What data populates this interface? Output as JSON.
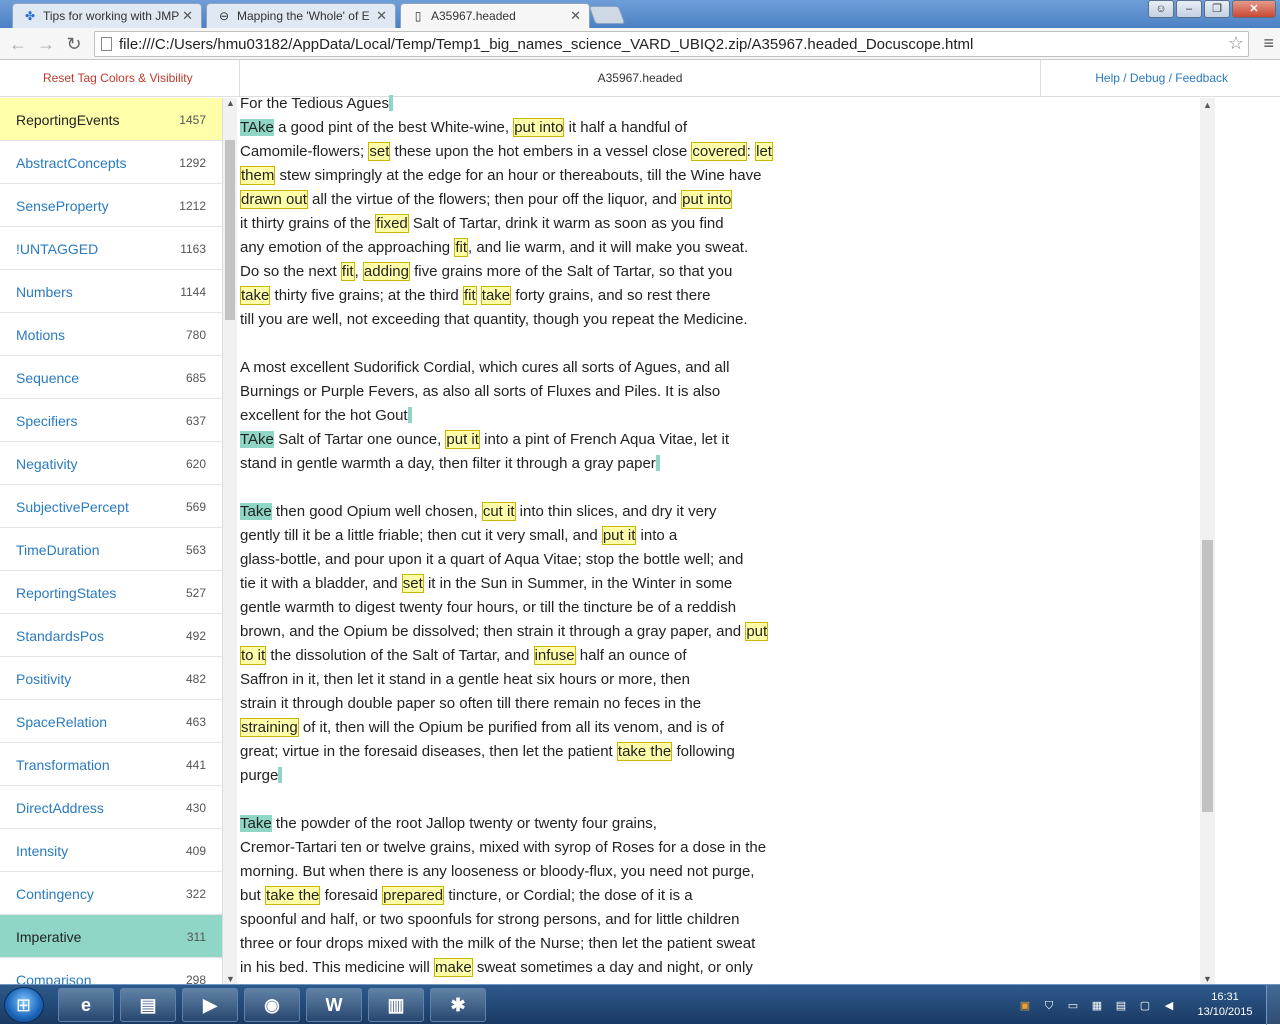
{
  "browser": {
    "tabs": [
      {
        "label": "Tips for working with JMP",
        "icon": "jmp-favicon"
      },
      {
        "label": "Mapping the 'Whole' of E",
        "icon": "globe-favicon"
      },
      {
        "label": "A35967.headed",
        "icon": "page-favicon"
      }
    ],
    "url": "file:///C:/Users/hmu03182/AppData/Local/Temp/Temp1_big_names_science_VARD_UBIQ2.zip/A35967.headed_Docuscope.html"
  },
  "page": {
    "reset_label": "Reset Tag Colors & Visibility",
    "title": "A35967.headed",
    "help_label": "Help / Debug / Feedback"
  },
  "sidebar": {
    "items": [
      {
        "label": "ReportingEvents",
        "count": "1457",
        "state": "yellow"
      },
      {
        "label": "AbstractConcepts",
        "count": "1292",
        "state": ""
      },
      {
        "label": "SenseProperty",
        "count": "1212",
        "state": ""
      },
      {
        "label": "!UNTAGGED",
        "count": "1163",
        "state": ""
      },
      {
        "label": "Numbers",
        "count": "1144",
        "state": ""
      },
      {
        "label": "Motions",
        "count": "780",
        "state": ""
      },
      {
        "label": "Sequence",
        "count": "685",
        "state": ""
      },
      {
        "label": "Specifiers",
        "count": "637",
        "state": ""
      },
      {
        "label": "Negativity",
        "count": "620",
        "state": ""
      },
      {
        "label": "SubjectivePercept",
        "count": "569",
        "state": ""
      },
      {
        "label": "TimeDuration",
        "count": "563",
        "state": ""
      },
      {
        "label": "ReportingStates",
        "count": "527",
        "state": ""
      },
      {
        "label": "StandardsPos",
        "count": "492",
        "state": ""
      },
      {
        "label": "Positivity",
        "count": "482",
        "state": ""
      },
      {
        "label": "SpaceRelation",
        "count": "463",
        "state": ""
      },
      {
        "label": "Transformation",
        "count": "441",
        "state": ""
      },
      {
        "label": "DirectAddress",
        "count": "430",
        "state": ""
      },
      {
        "label": "Intensity",
        "count": "409",
        "state": ""
      },
      {
        "label": "Contingency",
        "count": "322",
        "state": ""
      },
      {
        "label": "Imperative",
        "count": "311",
        "state": "teal"
      },
      {
        "label": "Comparison",
        "count": "298",
        "state": ""
      }
    ]
  },
  "document": {
    "lines": [
      [
        [
          "For the Tedious Agues",
          ""
        ],
        [
          "",
          "p"
        ]
      ],
      [
        [
          "TAke",
          "t"
        ],
        [
          " a good pint of the best White-wine, ",
          ""
        ],
        [
          "put into",
          "y"
        ],
        [
          " it half a handful of",
          ""
        ]
      ],
      [
        [
          "Camomile-flowers; ",
          ""
        ],
        [
          "set",
          "y"
        ],
        [
          " these upon the hot embers in a vessel close ",
          ""
        ],
        [
          "covered",
          "y"
        ],
        [
          ": ",
          ""
        ],
        [
          "let",
          "y"
        ]
      ],
      [
        [
          "them",
          "y"
        ],
        [
          " stew simpringly at the edge for an hour or thereabouts, till the Wine have",
          ""
        ]
      ],
      [
        [
          "drawn out",
          "y"
        ],
        [
          " all the virtue of the flowers; then pour off the liquor, and ",
          ""
        ],
        [
          "put into",
          "y"
        ]
      ],
      [
        [
          "it thirty grains of the ",
          ""
        ],
        [
          "fixed",
          "y"
        ],
        [
          " Salt of Tartar, drink it warm as soon as you find",
          ""
        ]
      ],
      [
        [
          "any emotion of the approaching ",
          ""
        ],
        [
          "fit",
          "y"
        ],
        [
          ", and lie warm, and it will make you sweat.",
          ""
        ]
      ],
      [
        [
          "Do so the next ",
          ""
        ],
        [
          "fit",
          "y"
        ],
        [
          ", ",
          ""
        ],
        [
          "adding",
          "y"
        ],
        [
          " five grains more of the Salt of Tartar, so that you",
          ""
        ]
      ],
      [
        [
          "take",
          "y"
        ],
        [
          " thirty five grains; at the third ",
          ""
        ],
        [
          "fit",
          "y"
        ],
        [
          " ",
          ""
        ],
        [
          "take",
          "y"
        ],
        [
          " forty grains, and so rest there",
          ""
        ]
      ],
      [
        [
          "till you are well, not exceeding that quantity, though you repeat the Medicine.",
          ""
        ]
      ],
      [],
      [
        [
          "A most excellent Sudorifick Cordial, which cures all sorts of Agues, and all",
          ""
        ]
      ],
      [
        [
          "Burnings or Purple Fevers, as also all sorts of Fluxes and Piles. It is also",
          ""
        ]
      ],
      [
        [
          "excellent for the hot Gout",
          ""
        ],
        [
          "",
          "p"
        ]
      ],
      [
        [
          "TAke",
          "t"
        ],
        [
          " Salt of Tartar one ounce, ",
          ""
        ],
        [
          "put it",
          "y"
        ],
        [
          " into a pint of French Aqua Vitae, let it",
          ""
        ]
      ],
      [
        [
          "stand in gentle warmth a day, then filter it through a gray paper",
          ""
        ],
        [
          "",
          "p"
        ]
      ],
      [],
      [
        [
          "Take",
          "t"
        ],
        [
          " then good Opium well chosen, ",
          ""
        ],
        [
          "cut it",
          "y"
        ],
        [
          " into thin slices, and dry it very",
          ""
        ]
      ],
      [
        [
          "gently till it be a little friable; then cut it very small, and ",
          ""
        ],
        [
          "put it",
          "y"
        ],
        [
          " into a",
          ""
        ]
      ],
      [
        [
          "glass-bottle, and pour upon it a quart of Aqua Vitae; stop the bottle well; and",
          ""
        ]
      ],
      [
        [
          "tie it with a bladder, and ",
          ""
        ],
        [
          "set",
          "y"
        ],
        [
          " it in the Sun in Summer, in the Winter in some",
          ""
        ]
      ],
      [
        [
          "gentle warmth to digest twenty four hours, or till the tincture be of a reddish",
          ""
        ]
      ],
      [
        [
          "brown, and the Opium be dissolved; then strain it through a gray paper, and ",
          ""
        ],
        [
          "put",
          "y"
        ]
      ],
      [
        [
          "to it",
          "y"
        ],
        [
          " the dissolution of the Salt of Tartar, and ",
          ""
        ],
        [
          "infuse",
          "y"
        ],
        [
          " half an ounce of",
          ""
        ]
      ],
      [
        [
          "Saffron in it, then let it stand in a gentle heat six hours or more, then",
          ""
        ]
      ],
      [
        [
          "strain it through double paper so often till there remain no feces in the",
          ""
        ]
      ],
      [
        [
          "straining",
          "y"
        ],
        [
          " of it, then will the Opium be purified from all its venom, and is of",
          ""
        ]
      ],
      [
        [
          "great; virtue in the foresaid diseases, then let the patient ",
          ""
        ],
        [
          "take the",
          "y"
        ],
        [
          " following",
          ""
        ]
      ],
      [
        [
          "purge",
          ""
        ],
        [
          "",
          "p"
        ]
      ],
      [],
      [
        [
          "Take",
          "t"
        ],
        [
          " the powder of the root Jallop twenty or twenty four grains,",
          ""
        ]
      ],
      [
        [
          "Cremor-Tartari ten or twelve grains, mixed with syrop of Roses for a dose in the",
          ""
        ]
      ],
      [
        [
          "morning. But when there is any looseness or bloody-flux, you need not purge,",
          ""
        ]
      ],
      [
        [
          "but ",
          ""
        ],
        [
          "take the",
          "y"
        ],
        [
          " foresaid ",
          ""
        ],
        [
          "prepared",
          "y"
        ],
        [
          " tincture, or Cordial; the dose of it is a",
          ""
        ]
      ],
      [
        [
          "spoonful and half, or two spoonfuls for strong persons, and for little children",
          ""
        ]
      ],
      [
        [
          "three or four drops mixed with the milk of the Nurse; then let the patient sweat",
          ""
        ]
      ],
      [
        [
          "in his bed. This medicine will ",
          ""
        ],
        [
          "make",
          "y"
        ],
        [
          " sweat sometimes a day and night, or only",
          ""
        ]
      ]
    ]
  },
  "taskbar": {
    "apps": [
      {
        "name": "internet-explorer",
        "glyph": "e"
      },
      {
        "name": "file-explorer",
        "glyph": "▤"
      },
      {
        "name": "media-player",
        "glyph": "▶"
      },
      {
        "name": "chrome",
        "glyph": "◉"
      },
      {
        "name": "word",
        "glyph": "W"
      },
      {
        "name": "excel-chart-app",
        "glyph": "▥"
      },
      {
        "name": "red-app",
        "glyph": "✱"
      }
    ],
    "time": "16:31",
    "date": "13/10/2015"
  },
  "colors": {
    "yellow_tag": "#ffffaa",
    "teal_tag": "#8fd6c6",
    "link": "#2a7bbf",
    "reset": "#c0392b"
  }
}
